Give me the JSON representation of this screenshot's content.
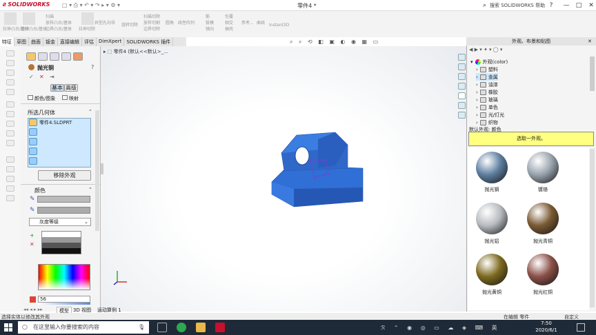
{
  "app": {
    "brand": "SOLIDWORKS",
    "doc_title": "零件4 *",
    "search_placeholder": "搜索 SOLIDWORKS 帮助",
    "help_icon": "?",
    "minimize": "—",
    "maximize": "□",
    "close": "✕"
  },
  "ribbon": {
    "items": [
      "拉伸凸台/基体",
      "旋转凸台/基体",
      "扫描",
      "放样凸台/基体",
      "边界凸台/基体",
      "拉伸切除",
      "异型孔向导",
      "旋转切除",
      "扫描切除",
      "放样切割",
      "边界切除",
      "圆角",
      "线性阵列",
      "筋",
      "包覆",
      "参考...",
      "曲线",
      "Instant3D",
      "拔模",
      "相交",
      "抽壳",
      "镜向"
    ]
  },
  "tabs": [
    "特征",
    "草图",
    "曲面",
    "钣金",
    "直接编辑",
    "评估",
    "DimXpert",
    "SOLIDWORKS 插件"
  ],
  "breadcrumb": "零件4 (默认<<默认>_...",
  "pm": {
    "title": "抛光铜",
    "help": "?",
    "ok": "✓",
    "cancel": "✕",
    "pin": "⇥",
    "mode_basic": "基本",
    "mode_advanced": "高级",
    "color_tab": "颜色/图象",
    "mapping_tab": "映射",
    "section_geometry": "所选几何体",
    "geometry_item": "零件4.SLDPRT",
    "remove_button": "移除外观",
    "section_color": "颜色",
    "palette": "灰度等级",
    "value": "56"
  },
  "right_pane": {
    "title": "外观、布景和贴图",
    "tree_root": "外观(color)",
    "tree_items": [
      "塑料",
      "金属",
      "油漆",
      "橡胶",
      "玻璃",
      "单色",
      "光/灯光",
      "织物"
    ],
    "selected_index": 1,
    "default_label": "默认外观: 颜色",
    "hint": "选取一外观。",
    "gallery": [
      {
        "label": "抛光钢",
        "color": "#5f7fa0"
      },
      {
        "label": "镀铬",
        "color": "#9aa4ae"
      },
      {
        "label": "抛光铝",
        "color": "#b8bcc0"
      },
      {
        "label": "抛光青铜",
        "color": "#7a5a34"
      },
      {
        "label": "抛光黄铜",
        "color": "#7d6a20"
      },
      {
        "label": "抛光红铜",
        "color": "#8a5048"
      }
    ]
  },
  "model_tabs": [
    "模型",
    "3D 视图",
    "运动算例 1"
  ],
  "status": {
    "left": "选择实体以修改其外观",
    "editing": "在编辑 零件",
    "custom": "自定义"
  },
  "taskbar": {
    "search": "在这里输入你要搜索的内容",
    "time": "7:50",
    "date": "2020/6/1"
  },
  "colors": {
    "part_blue": "#2f6fd6",
    "highlight_yellow": "#ffff80",
    "selection_blue": "#cde8ff"
  }
}
